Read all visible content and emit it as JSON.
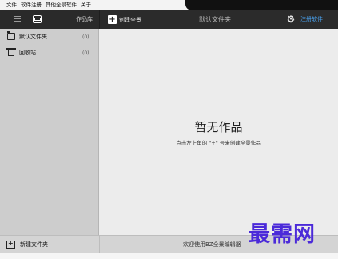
{
  "menu": [
    "文件",
    "软件注册",
    "其他全景软件",
    "关于"
  ],
  "library": {
    "label": "作品库"
  },
  "toolbar": {
    "create_label": "创建全景",
    "folder_title": "默认文件夹",
    "register_label": "注册软件",
    "create_icon": "plus-icon",
    "settings_icon": "gear-icon"
  },
  "sidebar": {
    "items": [
      {
        "icon": "folder-icon",
        "label": "默认文件夹",
        "count": "(0)"
      },
      {
        "icon": "trash-icon",
        "label": "回收站",
        "count": "(0)"
      }
    ],
    "new_folder_label": "新建文件夹"
  },
  "empty_state": {
    "title": "暂无作品",
    "hint": "点击左上角的 \"+\" 号来创建全景作品"
  },
  "status": {
    "welcome": "欢迎使用BZ全景编辑器"
  },
  "watermark": "最需网",
  "colors": {
    "header": "#2b2b2b",
    "sidebar": "#cdcdcd",
    "content": "#ececec",
    "link": "#4aa3f0",
    "watermark": "#4b2ad9"
  }
}
